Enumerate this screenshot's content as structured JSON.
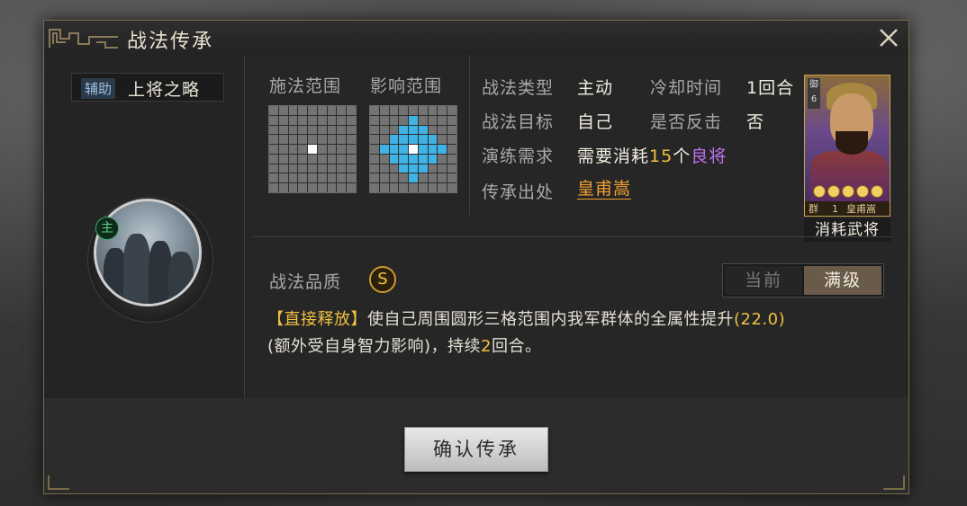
{
  "dialog": {
    "title": "战法传承",
    "close_label": "✕"
  },
  "skill": {
    "type_tag": "辅助",
    "name": "上将之略",
    "badge": "主"
  },
  "ranges": {
    "cast_label": "施法范围",
    "effect_label": "影响范围",
    "cast_grid": {
      "size": 9,
      "center": [
        4,
        4
      ],
      "highlight": []
    },
    "effect_grid": {
      "size": 9,
      "center": [
        4,
        4
      ],
      "highlight_diamond_radius": 3
    }
  },
  "info": {
    "type_label": "战法类型",
    "type_value": "主动",
    "cooldown_label": "冷却时间",
    "cooldown_value": "1回合",
    "target_label": "战法目标",
    "target_value": "自己",
    "counter_label": "是否反击",
    "counter_value": "否",
    "train_label": "演练需求",
    "train_prefix": "需要消耗",
    "train_count": "15",
    "train_mid": "个",
    "train_item": "良将",
    "origin_label": "传承出处",
    "origin_value": "皇甫嵩"
  },
  "general_card": {
    "cost": "御6",
    "stars": 5,
    "faction": "群",
    "level": "1",
    "name": "皇甫嵩",
    "label": "消耗武将"
  },
  "quality": {
    "label": "战法品质",
    "value": "S"
  },
  "toggle": {
    "current": "当前",
    "max": "满级",
    "selected": "满级"
  },
  "description": {
    "tag": "【直接释放】",
    "text1": "使自己周围圆形三格范围内我军群体的全属性提升",
    "value1": "(22.0)",
    "text2": "(额外受自身智力影响)，持续",
    "value2": "2",
    "text3": "回合。"
  },
  "colors": {
    "accent_gold": "#f0c040",
    "grid_blue": "#3fb3e6",
    "train_item_purple": "#c070f0",
    "origin_orange": "#f0a030"
  },
  "footer": {
    "confirm_label": "确认传承"
  }
}
